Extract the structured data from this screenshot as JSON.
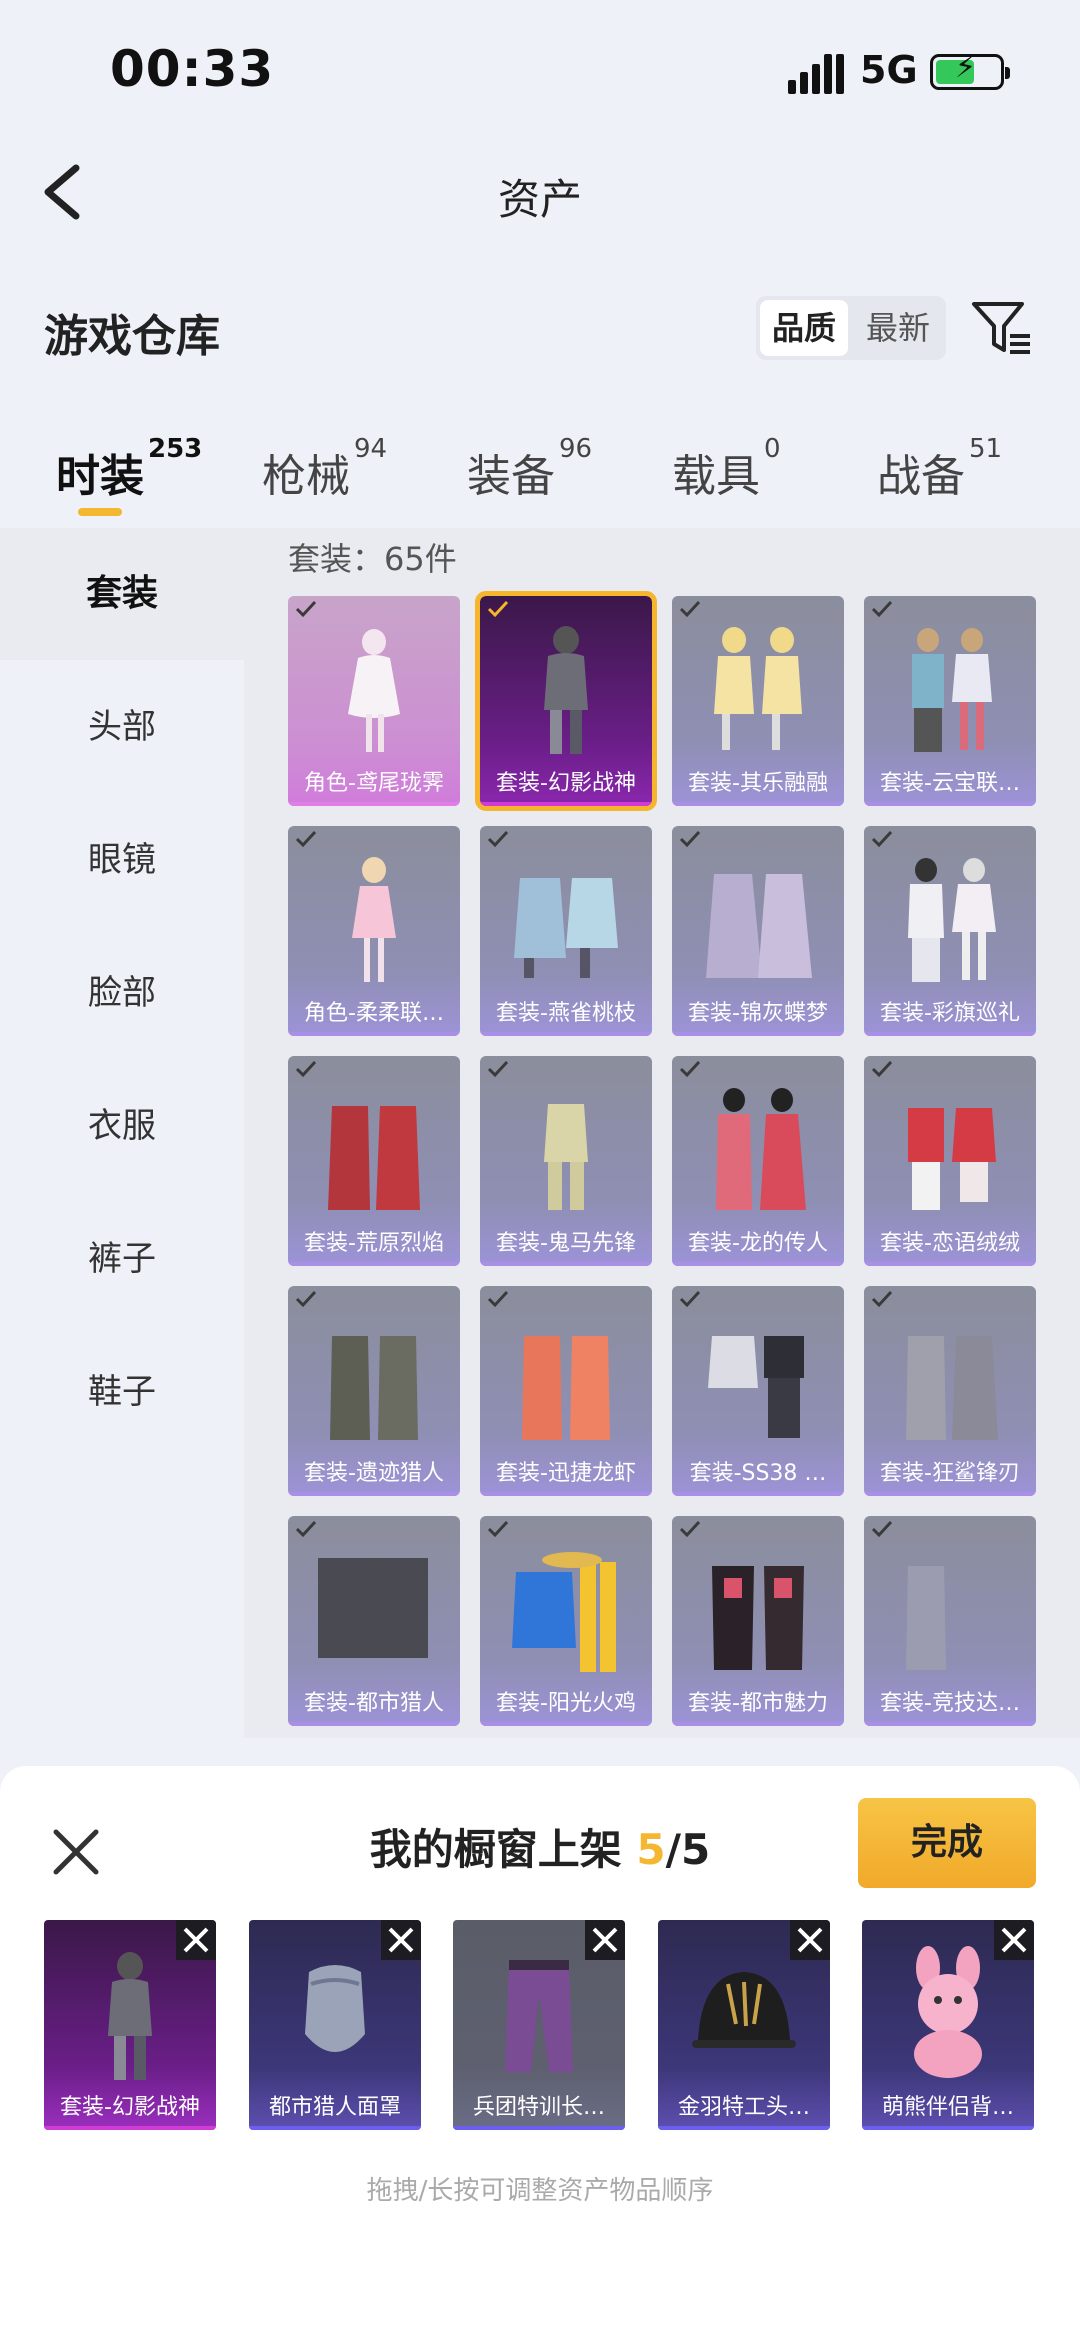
{
  "status": {
    "time": "00:33",
    "network": "5G"
  },
  "nav": {
    "title": "资产"
  },
  "section": {
    "title": "游戏仓库",
    "sort_options": [
      "品质",
      "最新"
    ]
  },
  "tabs": [
    {
      "label": "时装",
      "count": "253"
    },
    {
      "label": "枪械",
      "count": "94"
    },
    {
      "label": "装备",
      "count": "96"
    },
    {
      "label": "载具",
      "count": "0"
    },
    {
      "label": "战备",
      "count": "51"
    }
  ],
  "sidebar": [
    "套装",
    "头部",
    "眼镜",
    "脸部",
    "衣服",
    "裤子",
    "鞋子"
  ],
  "content": {
    "count_label": "套装：65件",
    "items": [
      "角色-鸢尾珑霁",
      "套装-幻影战神",
      "套装-其乐融融",
      "套装-云宝联…",
      "角色-柔柔联…",
      "套装-燕雀桃枝",
      "套装-锦灰蝶梦",
      "套装-彩旗巡礼",
      "套装-荒原烈焰",
      "套装-鬼马先锋",
      "套装-龙的传人",
      "套装-恋语绒绒",
      "套装-遗迹猎人",
      "套装-迅捷龙虾",
      "套装-SS38 …",
      "套装-狂鲨锋刃",
      "套装-都市猎人",
      "套装-阳光火鸡",
      "套装-都市魅力",
      "套装-竞技达…"
    ]
  },
  "sheet": {
    "title_prefix": "我的橱窗上架",
    "current": "5",
    "total": "/5",
    "done_label": "完成",
    "items": [
      "套装-幻影战神",
      "都市猎人面罩",
      "兵团特训长…",
      "金羽特工头…",
      "萌熊伴侣背…"
    ],
    "hint": "拖拽/长按可调整资产物品顺序"
  },
  "colors": {
    "accent": "#f5b731",
    "selected_border": "#f6b52b",
    "background": "#eef1f7"
  }
}
